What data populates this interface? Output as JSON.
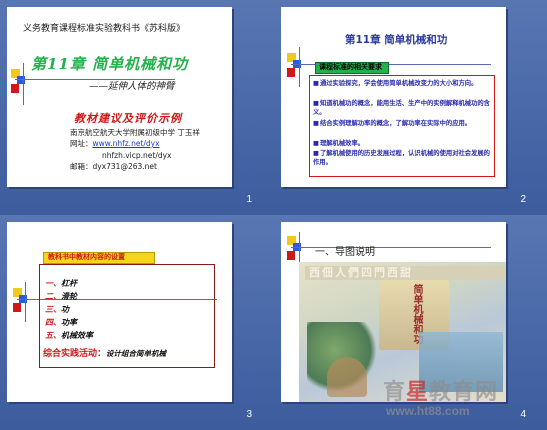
{
  "slides": [
    {
      "number": "1",
      "header": "义务教育课程标准实验教科书《苏科版》",
      "chapter": "第11章  简单机械和功",
      "subtitle": "——延伸人体的神臂",
      "red_title": "教材建议及评价示例",
      "line1": "南京航空航天大学附属初级中学  丁玉祥",
      "line2_label": "网址：",
      "line2_link": "www.nhfz.net/dyx",
      "line3": "nhfzh.vicp.net/dyx",
      "line4": "邮箱：dyx731@263.net"
    },
    {
      "number": "2",
      "title": "第11章    简单机械和功",
      "box_label": "课程标准的相关要求",
      "items": [
        "通过实验探究，学会使用简单机械改变力的大小和方向。",
        "知道机械功的概念，能用生活、生产中的实例解释机械功的含义。",
        "结合实例理解功率的概念，了解功率在实际中的应用。",
        "理解机械效率。",
        "了解机械使用的历史发展过程，认识机械的使用对社会发展的作用。"
      ]
    },
    {
      "number": "3",
      "box_label": "教科书中教材内容的设置",
      "items": [
        {
          "prefix": "一、",
          "text": "杠杆"
        },
        {
          "prefix": "二、",
          "text": "滑轮"
        },
        {
          "prefix": "三、",
          "text": "功"
        },
        {
          "prefix": "四、",
          "text": "功率"
        },
        {
          "prefix": "五、",
          "text": "机械效率"
        }
      ],
      "last_label": "综合实践活动：",
      "last_text": "设计组合简单机械"
    },
    {
      "number": "4",
      "title": "一、导图说明",
      "banner": "西佃人們四門西甜",
      "book_text": "简单机械和功"
    }
  ],
  "watermark": {
    "line1_red": "育",
    "line1_mid": "星",
    "line1_rest": "教育网",
    "line2": "www.ht88.com"
  },
  "colors": {
    "background": "#4a6aa8",
    "chapter_green": "#22b14c",
    "accent_red": "#d01818",
    "link_blue": "#1a3fd8"
  }
}
